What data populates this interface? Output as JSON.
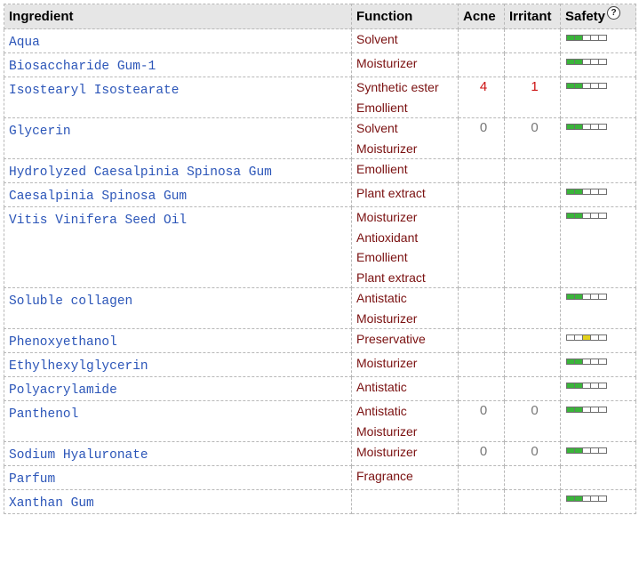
{
  "columns": {
    "ingredient": "Ingredient",
    "function": "Function",
    "acne": "Acne",
    "irritant": "Irritant",
    "safety": "Safety"
  },
  "help_icon_label": "?",
  "colors": {
    "green": "#3ab53a",
    "yellow": "#e3d21c",
    "link": "#2b55b8",
    "function": "#7a1010",
    "acne_high": "#cc1111"
  },
  "rows": [
    {
      "name": "Aqua",
      "functions": [
        "Solvent"
      ],
      "acne": "",
      "irritant": "",
      "safety": {
        "level": 2,
        "color": "green"
      }
    },
    {
      "name": "Biosaccharide Gum-1",
      "functions": [
        "Moisturizer"
      ],
      "acne": "",
      "irritant": "",
      "safety": {
        "level": 2,
        "color": "green"
      }
    },
    {
      "name": "Isostearyl Isostearate",
      "functions": [
        "Synthetic ester",
        "Emollient"
      ],
      "acne": "4",
      "irritant": "1",
      "safety": {
        "level": 2,
        "color": "green"
      }
    },
    {
      "name": "Glycerin",
      "functions": [
        "Solvent",
        "Moisturizer"
      ],
      "acne": "0",
      "irritant": "0",
      "safety": {
        "level": 2,
        "color": "green"
      }
    },
    {
      "name": "Hydrolyzed Caesalpinia Spinosa Gum",
      "functions": [
        "Emollient"
      ],
      "acne": "",
      "irritant": "",
      "safety": null
    },
    {
      "name": "Caesalpinia Spinosa Gum",
      "functions": [
        "Plant extract"
      ],
      "acne": "",
      "irritant": "",
      "safety": {
        "level": 2,
        "color": "green"
      }
    },
    {
      "name": "Vitis Vinifera Seed Oil",
      "functions": [
        "Moisturizer",
        "Antioxidant",
        "Emollient",
        "Plant extract"
      ],
      "acne": "",
      "irritant": "",
      "safety": {
        "level": 2,
        "color": "green"
      }
    },
    {
      "name": "Soluble collagen",
      "functions": [
        "Antistatic",
        "Moisturizer"
      ],
      "acne": "",
      "irritant": "",
      "safety": {
        "level": 2,
        "color": "green"
      }
    },
    {
      "name": "Phenoxyethanol",
      "functions": [
        "Preservative"
      ],
      "acne": "",
      "irritant": "",
      "safety": {
        "level": 3,
        "color": "yellow"
      }
    },
    {
      "name": "Ethylhexylglycerin",
      "functions": [
        "Moisturizer"
      ],
      "acne": "",
      "irritant": "",
      "safety": {
        "level": 2,
        "color": "green"
      }
    },
    {
      "name": "Polyacrylamide",
      "functions": [
        "Antistatic"
      ],
      "acne": "",
      "irritant": "",
      "safety": {
        "level": 2,
        "color": "green"
      }
    },
    {
      "name": "Panthenol",
      "functions": [
        "Antistatic",
        "Moisturizer"
      ],
      "acne": "0",
      "irritant": "0",
      "safety": {
        "level": 2,
        "color": "green"
      }
    },
    {
      "name": "Sodium Hyaluronate",
      "functions": [
        "Moisturizer"
      ],
      "acne": "0",
      "irritant": "0",
      "safety": {
        "level": 2,
        "color": "green"
      }
    },
    {
      "name": "Parfum",
      "functions": [
        "Fragrance"
      ],
      "acne": "",
      "irritant": "",
      "safety": null
    },
    {
      "name": "Xanthan Gum",
      "functions": [
        ""
      ],
      "acne": "",
      "irritant": "",
      "safety": {
        "level": 2,
        "color": "green"
      }
    }
  ]
}
